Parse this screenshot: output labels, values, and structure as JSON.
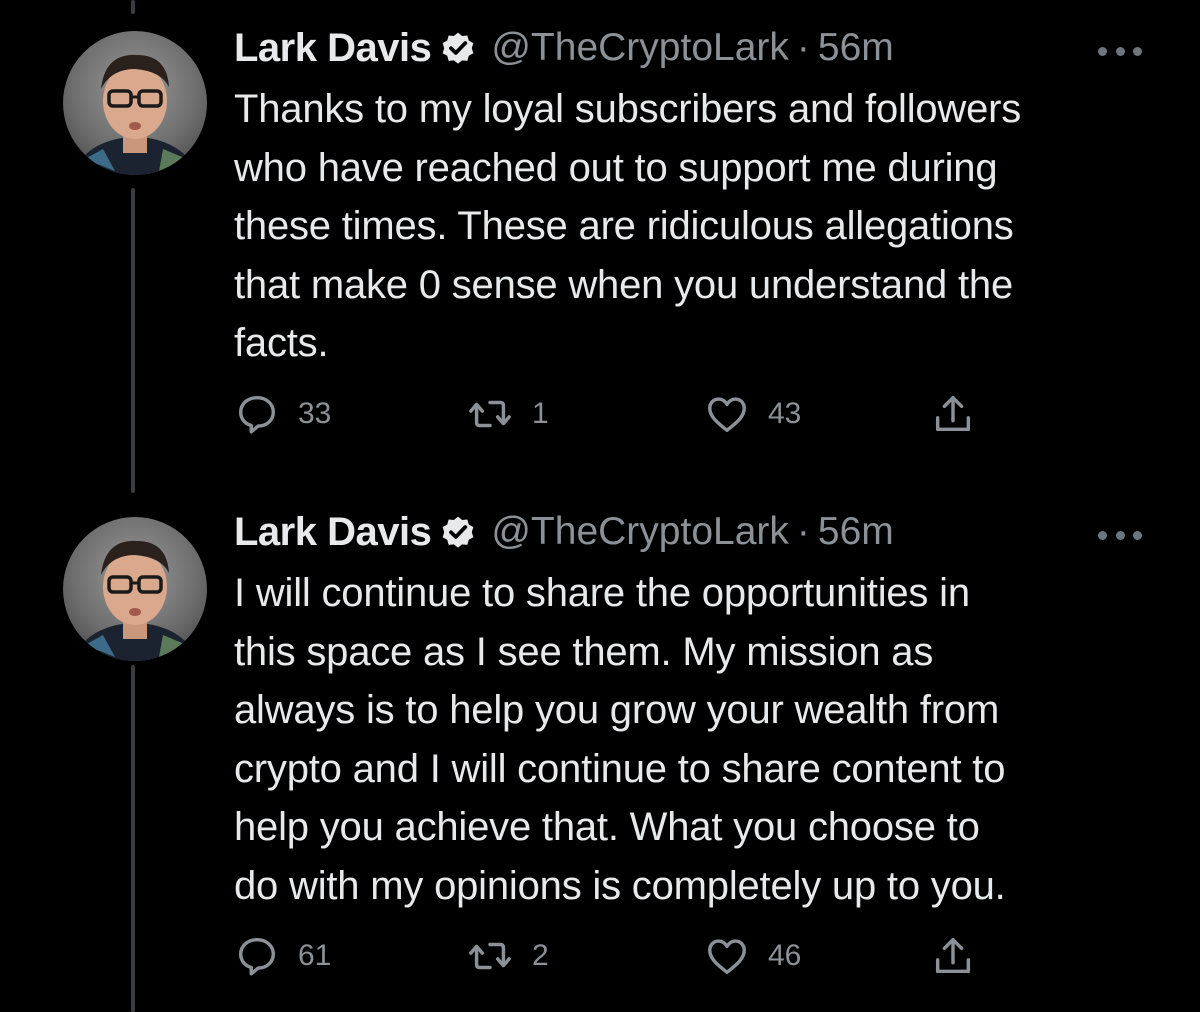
{
  "colors": {
    "background": "#000000",
    "text": "#e7e9ea",
    "muted": "#8b9196",
    "thread_line": "#3a3d40"
  },
  "tweets": [
    {
      "author": {
        "display_name": "Lark Davis",
        "verified_icon": "verified-badge-icon",
        "handle": "@TheCryptoLark",
        "separator": "·",
        "time": "56m"
      },
      "text": "Thanks to my loyal subscribers and followers\nwho have reached out to support me during\nthese times. These are ridiculous allegations\nthat make 0 sense when you understand the\nfacts.",
      "actions": {
        "reply_count": "33",
        "retweet_count": "1",
        "like_count": "43"
      }
    },
    {
      "author": {
        "display_name": "Lark Davis",
        "verified_icon": "verified-badge-icon",
        "handle": "@TheCryptoLark",
        "separator": "·",
        "time": "56m"
      },
      "text": "I will continue to share the opportunities in\nthis space as I see them. My mission as\nalways is to help you grow your wealth from\ncrypto and I will continue to share content to\nhelp you achieve that. What you choose to\ndo with my opinions is completely up to you.",
      "actions": {
        "reply_count": "61",
        "retweet_count": "2",
        "like_count": "46"
      }
    }
  ]
}
